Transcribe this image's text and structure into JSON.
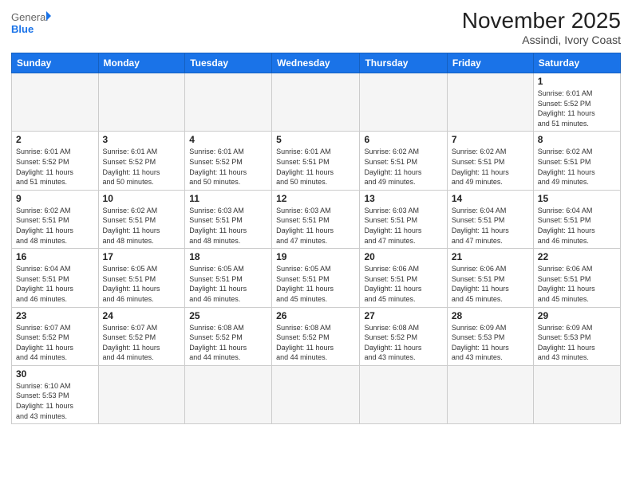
{
  "header": {
    "logo_general": "General",
    "logo_blue": "Blue",
    "title": "November 2025",
    "subtitle": "Assindi, Ivory Coast"
  },
  "weekdays": [
    "Sunday",
    "Monday",
    "Tuesday",
    "Wednesday",
    "Thursday",
    "Friday",
    "Saturday"
  ],
  "weeks": [
    [
      {
        "day": "",
        "info": ""
      },
      {
        "day": "",
        "info": ""
      },
      {
        "day": "",
        "info": ""
      },
      {
        "day": "",
        "info": ""
      },
      {
        "day": "",
        "info": ""
      },
      {
        "day": "",
        "info": ""
      },
      {
        "day": "1",
        "info": "Sunrise: 6:01 AM\nSunset: 5:52 PM\nDaylight: 11 hours\nand 51 minutes."
      }
    ],
    [
      {
        "day": "2",
        "info": "Sunrise: 6:01 AM\nSunset: 5:52 PM\nDaylight: 11 hours\nand 51 minutes."
      },
      {
        "day": "3",
        "info": "Sunrise: 6:01 AM\nSunset: 5:52 PM\nDaylight: 11 hours\nand 50 minutes."
      },
      {
        "day": "4",
        "info": "Sunrise: 6:01 AM\nSunset: 5:52 PM\nDaylight: 11 hours\nand 50 minutes."
      },
      {
        "day": "5",
        "info": "Sunrise: 6:01 AM\nSunset: 5:51 PM\nDaylight: 11 hours\nand 50 minutes."
      },
      {
        "day": "6",
        "info": "Sunrise: 6:02 AM\nSunset: 5:51 PM\nDaylight: 11 hours\nand 49 minutes."
      },
      {
        "day": "7",
        "info": "Sunrise: 6:02 AM\nSunset: 5:51 PM\nDaylight: 11 hours\nand 49 minutes."
      },
      {
        "day": "8",
        "info": "Sunrise: 6:02 AM\nSunset: 5:51 PM\nDaylight: 11 hours\nand 49 minutes."
      }
    ],
    [
      {
        "day": "9",
        "info": "Sunrise: 6:02 AM\nSunset: 5:51 PM\nDaylight: 11 hours\nand 48 minutes."
      },
      {
        "day": "10",
        "info": "Sunrise: 6:02 AM\nSunset: 5:51 PM\nDaylight: 11 hours\nand 48 minutes."
      },
      {
        "day": "11",
        "info": "Sunrise: 6:03 AM\nSunset: 5:51 PM\nDaylight: 11 hours\nand 48 minutes."
      },
      {
        "day": "12",
        "info": "Sunrise: 6:03 AM\nSunset: 5:51 PM\nDaylight: 11 hours\nand 47 minutes."
      },
      {
        "day": "13",
        "info": "Sunrise: 6:03 AM\nSunset: 5:51 PM\nDaylight: 11 hours\nand 47 minutes."
      },
      {
        "day": "14",
        "info": "Sunrise: 6:04 AM\nSunset: 5:51 PM\nDaylight: 11 hours\nand 47 minutes."
      },
      {
        "day": "15",
        "info": "Sunrise: 6:04 AM\nSunset: 5:51 PM\nDaylight: 11 hours\nand 46 minutes."
      }
    ],
    [
      {
        "day": "16",
        "info": "Sunrise: 6:04 AM\nSunset: 5:51 PM\nDaylight: 11 hours\nand 46 minutes."
      },
      {
        "day": "17",
        "info": "Sunrise: 6:05 AM\nSunset: 5:51 PM\nDaylight: 11 hours\nand 46 minutes."
      },
      {
        "day": "18",
        "info": "Sunrise: 6:05 AM\nSunset: 5:51 PM\nDaylight: 11 hours\nand 46 minutes."
      },
      {
        "day": "19",
        "info": "Sunrise: 6:05 AM\nSunset: 5:51 PM\nDaylight: 11 hours\nand 45 minutes."
      },
      {
        "day": "20",
        "info": "Sunrise: 6:06 AM\nSunset: 5:51 PM\nDaylight: 11 hours\nand 45 minutes."
      },
      {
        "day": "21",
        "info": "Sunrise: 6:06 AM\nSunset: 5:51 PM\nDaylight: 11 hours\nand 45 minutes."
      },
      {
        "day": "22",
        "info": "Sunrise: 6:06 AM\nSunset: 5:51 PM\nDaylight: 11 hours\nand 45 minutes."
      }
    ],
    [
      {
        "day": "23",
        "info": "Sunrise: 6:07 AM\nSunset: 5:52 PM\nDaylight: 11 hours\nand 44 minutes."
      },
      {
        "day": "24",
        "info": "Sunrise: 6:07 AM\nSunset: 5:52 PM\nDaylight: 11 hours\nand 44 minutes."
      },
      {
        "day": "25",
        "info": "Sunrise: 6:08 AM\nSunset: 5:52 PM\nDaylight: 11 hours\nand 44 minutes."
      },
      {
        "day": "26",
        "info": "Sunrise: 6:08 AM\nSunset: 5:52 PM\nDaylight: 11 hours\nand 44 minutes."
      },
      {
        "day": "27",
        "info": "Sunrise: 6:08 AM\nSunset: 5:52 PM\nDaylight: 11 hours\nand 43 minutes."
      },
      {
        "day": "28",
        "info": "Sunrise: 6:09 AM\nSunset: 5:53 PM\nDaylight: 11 hours\nand 43 minutes."
      },
      {
        "day": "29",
        "info": "Sunrise: 6:09 AM\nSunset: 5:53 PM\nDaylight: 11 hours\nand 43 minutes."
      }
    ],
    [
      {
        "day": "30",
        "info": "Sunrise: 6:10 AM\nSunset: 5:53 PM\nDaylight: 11 hours\nand 43 minutes."
      },
      {
        "day": "",
        "info": ""
      },
      {
        "day": "",
        "info": ""
      },
      {
        "day": "",
        "info": ""
      },
      {
        "day": "",
        "info": ""
      },
      {
        "day": "",
        "info": ""
      },
      {
        "day": "",
        "info": ""
      }
    ]
  ]
}
